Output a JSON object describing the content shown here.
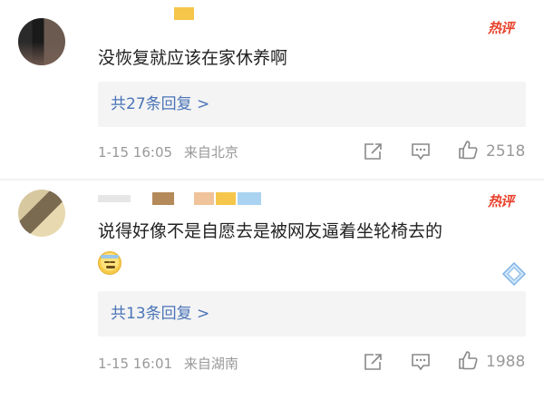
{
  "comments": [
    {
      "hot_label": "热评",
      "text": "没恢复就应该在家休养啊",
      "replies_label": "共27条回复 >",
      "time": "1-15 16:05",
      "location": "来自北京",
      "likes": "2518"
    },
    {
      "hot_label": "热评",
      "text": "说得好像不是自愿去是被网友逼着坐轮椅去的",
      "replies_label": "共13条回复 >",
      "time": "1-15 16:01",
      "location": "来自湖南",
      "likes": "1988"
    }
  ],
  "icons": {
    "share": "share-icon",
    "comment": "comment-icon",
    "like": "thumbs-up-icon",
    "emoji": "cold-sweat-emoji-icon",
    "sticker": "diamond-sticker-icon"
  },
  "colors": {
    "link": "#4a74b7",
    "hot": "#e8432c",
    "meta": "#999999"
  }
}
